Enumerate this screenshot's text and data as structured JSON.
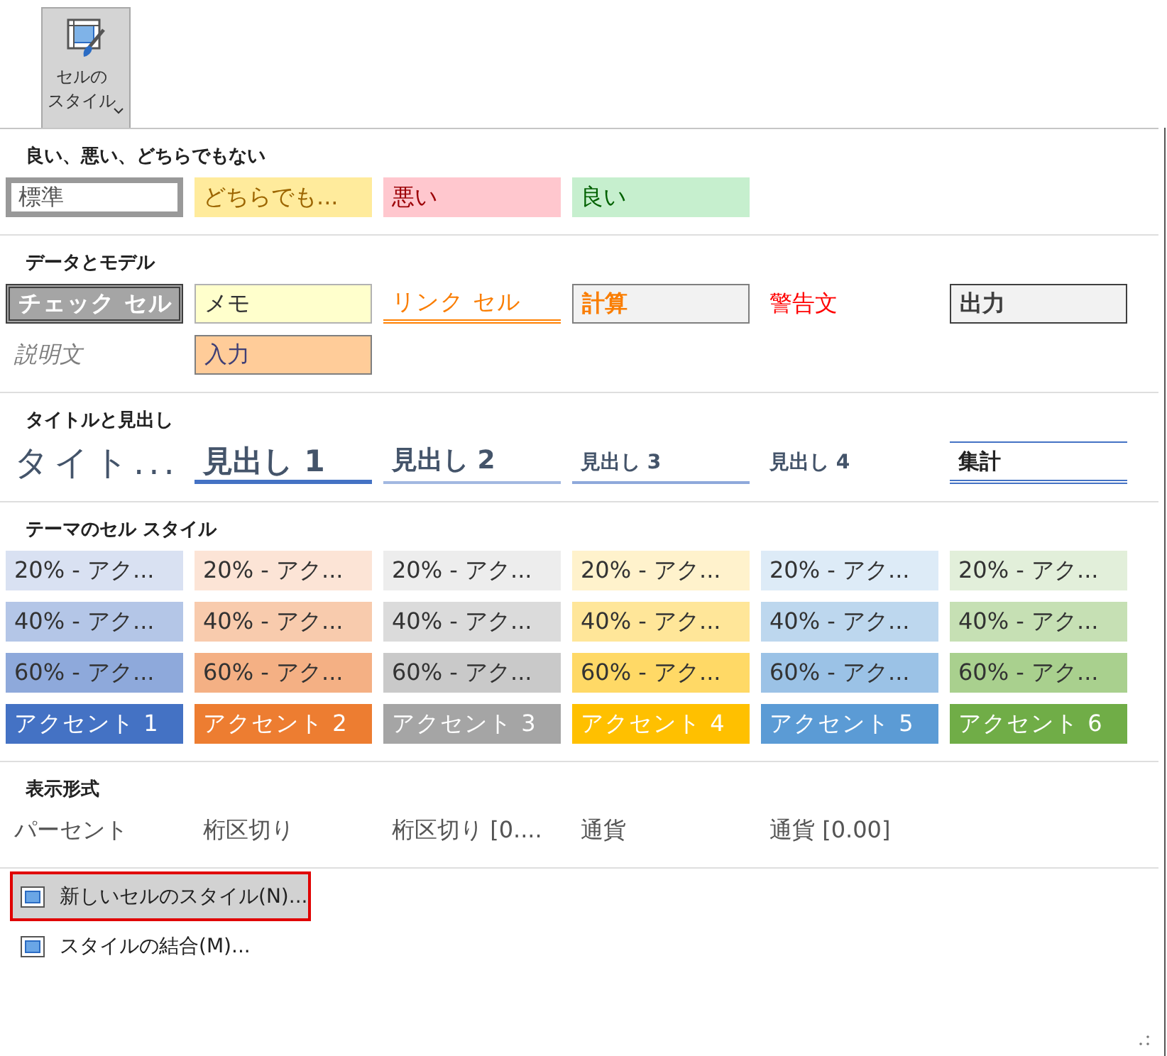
{
  "ribbon_button": {
    "label_lines": [
      "セルの",
      "スタイル"
    ],
    "selected": true
  },
  "sections": [
    {
      "heading": "良い、悪い、どちらでもない",
      "cells": [
        {
          "text": "標準",
          "kind": "normal"
        },
        {
          "text": "どちらでも...",
          "kind": "neutral"
        },
        {
          "text": "悪い",
          "kind": "bad"
        },
        {
          "text": "良い",
          "kind": "good"
        }
      ]
    },
    {
      "heading": "データとモデル",
      "cells": [
        {
          "text": "チェック セル",
          "kind": "check"
        },
        {
          "text": "メモ",
          "kind": "note"
        },
        {
          "text": "リンク セル",
          "kind": "link"
        },
        {
          "text": "計算",
          "kind": "calc"
        },
        {
          "text": "警告文",
          "kind": "warning"
        },
        {
          "text": "出力",
          "kind": "output"
        },
        {
          "text": "説明文",
          "kind": "explanatory"
        },
        {
          "text": "入力",
          "kind": "input"
        }
      ]
    },
    {
      "heading": "タイトルと見出し",
      "cells": [
        {
          "text": "タイト...",
          "kind": "title"
        },
        {
          "text": "見出し 1",
          "kind": "h1"
        },
        {
          "text": "見出し 2",
          "kind": "h2"
        },
        {
          "text": "見出し 3",
          "kind": "h3"
        },
        {
          "text": "見出し 4",
          "kind": "h4"
        },
        {
          "text": "集計",
          "kind": "total"
        }
      ]
    },
    {
      "heading": "テーマのセル スタイル",
      "cells": [
        {
          "text": "20% - アク...",
          "kind": "tint",
          "color": "#d9e1f2"
        },
        {
          "text": "20% - アク...",
          "kind": "tint",
          "color": "#fce4d6"
        },
        {
          "text": "20% - アク...",
          "kind": "tint",
          "color": "#ededed"
        },
        {
          "text": "20% - アク...",
          "kind": "tint",
          "color": "#fff2cc"
        },
        {
          "text": "20% - アク...",
          "kind": "tint",
          "color": "#ddebf7"
        },
        {
          "text": "20% - アク...",
          "kind": "tint",
          "color": "#e2efda"
        },
        {
          "text": "40% - アク...",
          "kind": "tint",
          "color": "#b4c6e7"
        },
        {
          "text": "40% - アク...",
          "kind": "tint",
          "color": "#f8cbad"
        },
        {
          "text": "40% - アク...",
          "kind": "tint",
          "color": "#dbdbdb"
        },
        {
          "text": "40% - アク...",
          "kind": "tint",
          "color": "#ffe699"
        },
        {
          "text": "40% - アク...",
          "kind": "tint",
          "color": "#bdd7ee"
        },
        {
          "text": "40% - アク...",
          "kind": "tint",
          "color": "#c6e0b4"
        },
        {
          "text": "60% - アク...",
          "kind": "tint",
          "color": "#8ea9db"
        },
        {
          "text": "60% - アク...",
          "kind": "tint",
          "color": "#f4b084"
        },
        {
          "text": "60% - アク...",
          "kind": "tint",
          "color": "#c9c9c9"
        },
        {
          "text": "60% - アク...",
          "kind": "tint",
          "color": "#ffd966"
        },
        {
          "text": "60% - アク...",
          "kind": "tint",
          "color": "#9bc2e6"
        },
        {
          "text": "60% - アク...",
          "kind": "tint",
          "color": "#a9d08e"
        },
        {
          "text": "アクセント 1",
          "kind": "accent",
          "color": "#4472c4"
        },
        {
          "text": "アクセント 2",
          "kind": "accent",
          "color": "#ed7d31"
        },
        {
          "text": "アクセント 3",
          "kind": "accent",
          "color": "#a5a5a5"
        },
        {
          "text": "アクセント 4",
          "kind": "accent",
          "color": "#ffc000"
        },
        {
          "text": "アクセント 5",
          "kind": "accent",
          "color": "#5b9bd5"
        },
        {
          "text": "アクセント 6",
          "kind": "accent",
          "color": "#70ad47"
        }
      ]
    },
    {
      "heading": "表示形式",
      "cells": [
        {
          "text": "パーセント",
          "kind": "plain"
        },
        {
          "text": "桁区切り",
          "kind": "plain"
        },
        {
          "text": "桁区切り [0....",
          "kind": "plain"
        },
        {
          "text": "通貨",
          "kind": "plain"
        },
        {
          "text": "通貨 [0.00]",
          "kind": "plain"
        }
      ]
    }
  ],
  "menu_items": [
    {
      "label": "新しいセルのスタイル(N)...",
      "selected": true,
      "highlighted": true
    },
    {
      "label": "スタイルの結合(M)...",
      "selected": false,
      "highlighted": false
    }
  ]
}
